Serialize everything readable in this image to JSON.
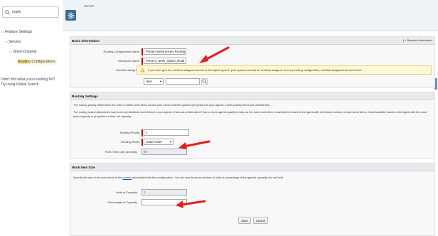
{
  "sidebar": {
    "search_value": "routin",
    "items": [
      {
        "label": "Feature Settings"
      },
      {
        "label": "Service"
      },
      {
        "label": "Omni-Channel"
      },
      {
        "label_hl": "Routin",
        "label_rest": "g Configurations"
      }
    ],
    "help_line1": "Didn't find what you're looking for?",
    "help_line2": "Try using Global Search."
  },
  "header": {
    "section_label": "SETUP"
  },
  "basic": {
    "title": "Basic Information",
    "required_note": "= Required Information",
    "routing_config_name_label": "Routing Configuration Name",
    "routing_config_name_value": "Present week issues Routing",
    "developer_name_label": "Developer Name",
    "developer_name_value": "Present_week_issues_Routi",
    "overflow_label": "Overflow Assignee",
    "overflow_warning": "If you don't give the overflow assignee access to the object types in your queues and set an overflow assignee to every routing configuration, overflow assignments won't work.",
    "overflow_type": "User"
  },
  "routing": {
    "title": "Routing Settings",
    "desc1": "The routing priority determines the order in which work items across your Omni-Channel queues get pushed to your agents. Lower-priority items are pushed first.",
    "desc2": "The routing model determines how to evenly distribute work items to your agents. If acts as a tiebreaker if two or more agents qualify to take on the same work item. Least Active routes to the agent with the fewest number of open work items. Most Available routes to the agent with the most open capacity in proportion to their set capacity.",
    "priority_label": "Routing Priority",
    "priority_value": "1",
    "model_label": "Routing Model",
    "model_value": "Least Active",
    "push_timeout_label": "Push Time-Out (seconds)",
    "push_timeout_value": "60"
  },
  "worksize": {
    "title": "Work Item Size",
    "desc_pre": "Specify the size of the work items in the ",
    "desc_link": "queues",
    "desc_post": " associated with this configuration. You can size items by number of units or percentage of the agent's capacity, but not both.",
    "units_label": "Units of Capacity",
    "units_value": "2",
    "percentage_label": "Percentage of Capacity"
  },
  "buttons": {
    "save": "Save",
    "cancel": "Cancel"
  },
  "colors": {
    "annotation_arrow": "#e51e1e",
    "required": "#cc0000",
    "setup_icon": "#3e6b96"
  }
}
